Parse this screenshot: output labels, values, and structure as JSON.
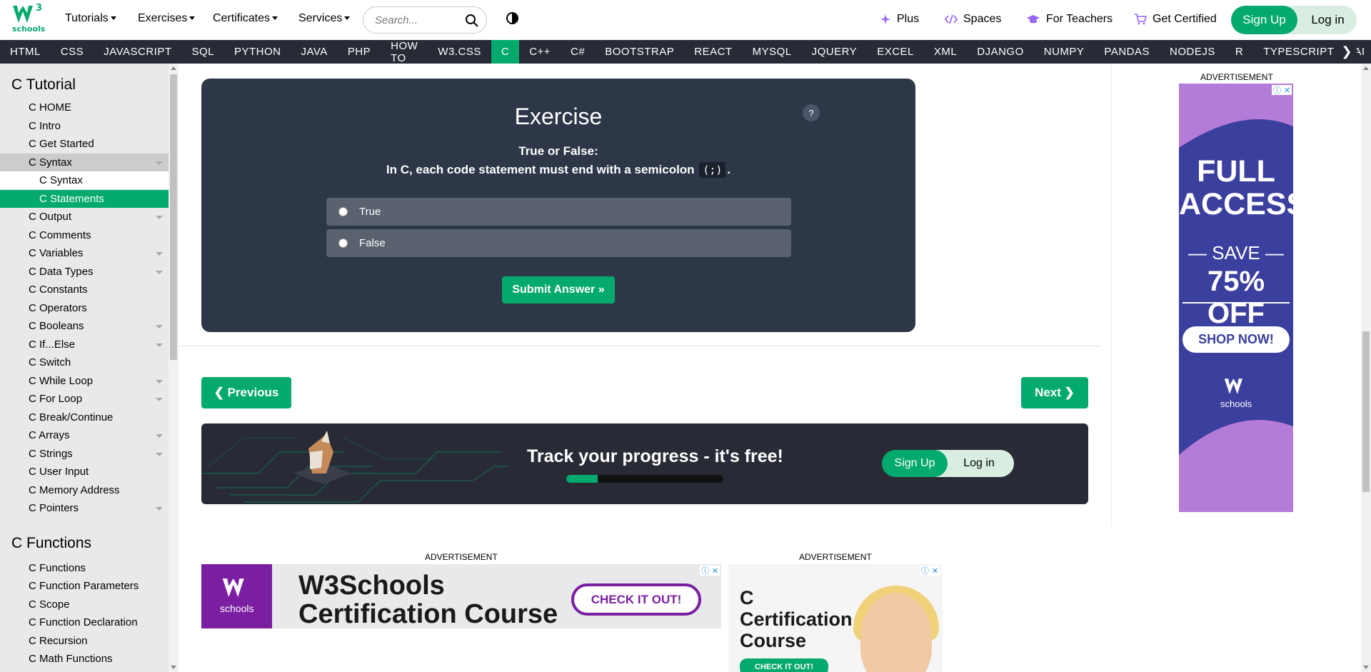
{
  "top": {
    "logo_sup": "3",
    "logo_text": "schools",
    "menus": [
      "Tutorials",
      "Exercises",
      "Certificates",
      "Services"
    ],
    "search_placeholder": "Search...",
    "right_links": [
      {
        "label": "Plus",
        "icon": "sparkle-icon"
      },
      {
        "label": "Spaces",
        "icon": "code-icon"
      },
      {
        "label": "For Teachers",
        "icon": "graduation-cap-icon"
      },
      {
        "label": "Get Certified",
        "icon": "cart-icon"
      }
    ],
    "signup": "Sign Up",
    "login": "Log in"
  },
  "nav": {
    "items": [
      "HTML",
      "CSS",
      "JAVASCRIPT",
      "SQL",
      "PYTHON",
      "JAVA",
      "PHP",
      "HOW TO",
      "W3.CSS",
      "C",
      "C++",
      "C#",
      "BOOTSTRAP",
      "REACT",
      "MYSQL",
      "JQUERY",
      "EXCEL",
      "XML",
      "DJANGO",
      "NUMPY",
      "PANDAS",
      "NODEJS",
      "R",
      "TYPESCRIPT",
      "AI"
    ],
    "active": "C",
    "more_arrow": "❯"
  },
  "sidebar": {
    "heading1": "C Tutorial",
    "items1": [
      {
        "label": "C HOME",
        "type": "item",
        "chev": false
      },
      {
        "label": "C Intro",
        "type": "item",
        "chev": false
      },
      {
        "label": "C Get Started",
        "type": "item",
        "chev": false
      },
      {
        "label": "C Syntax",
        "type": "open",
        "chev": true
      },
      {
        "label": "C Syntax",
        "type": "sub",
        "chev": false
      },
      {
        "label": "C Statements",
        "type": "active",
        "chev": false
      },
      {
        "label": "C Output",
        "type": "item",
        "chev": true
      },
      {
        "label": "C Comments",
        "type": "item",
        "chev": false
      },
      {
        "label": "C Variables",
        "type": "item",
        "chev": true
      },
      {
        "label": "C Data Types",
        "type": "item",
        "chev": true
      },
      {
        "label": "C Constants",
        "type": "item",
        "chev": false
      },
      {
        "label": "C Operators",
        "type": "item",
        "chev": false
      },
      {
        "label": "C Booleans",
        "type": "item",
        "chev": true
      },
      {
        "label": "C If...Else",
        "type": "item",
        "chev": true
      },
      {
        "label": "C Switch",
        "type": "item",
        "chev": false
      },
      {
        "label": "C While Loop",
        "type": "item",
        "chev": true
      },
      {
        "label": "C For Loop",
        "type": "item",
        "chev": true
      },
      {
        "label": "C Break/Continue",
        "type": "item",
        "chev": false
      },
      {
        "label": "C Arrays",
        "type": "item",
        "chev": true
      },
      {
        "label": "C Strings",
        "type": "item",
        "chev": true
      },
      {
        "label": "C User Input",
        "type": "item",
        "chev": false
      },
      {
        "label": "C Memory Address",
        "type": "item",
        "chev": false
      },
      {
        "label": "C Pointers",
        "type": "item",
        "chev": true
      }
    ],
    "heading2": "C Functions",
    "items2": [
      {
        "label": "C Functions"
      },
      {
        "label": "C Function Parameters"
      },
      {
        "label": "C Scope"
      },
      {
        "label": "C Function Declaration"
      },
      {
        "label": "C Recursion"
      },
      {
        "label": "C Math Functions"
      }
    ]
  },
  "exercise": {
    "title": "Exercise",
    "help": "?",
    "prompt": "True or False:",
    "statement_before": "In C, each code statement must end with a semicolon",
    "statement_code": "(;)",
    "statement_after": ".",
    "options": [
      "True",
      "False"
    ],
    "submit": "Submit Answer »"
  },
  "pager": {
    "previous": "❮ Previous",
    "next": "Next ❯"
  },
  "track": {
    "text": "Track your progress - it's free!",
    "progress": 0.2,
    "signup": "Sign Up",
    "login": "Log in"
  },
  "ads": {
    "label": "ADVERTISEMENT",
    "side": {
      "full": "FULL ACCESS",
      "save": "— SAVE —",
      "off": "75% OFF",
      "shop": "SHOP NOW!",
      "logo_text": "schools"
    },
    "bottom1": {
      "logo_text": "schools",
      "headline1": "W3Schools",
      "headline2": "Certification Course",
      "cta": "CHECK IT OUT!"
    },
    "bottom2": {
      "line1": "C",
      "line2": "Certification",
      "line3": "Course",
      "cta": "CHECK IT OUT!"
    }
  },
  "colors": {
    "brand": "#04AA6D",
    "nav_bg": "#282A35",
    "exercise_bg": "#2D3748"
  }
}
